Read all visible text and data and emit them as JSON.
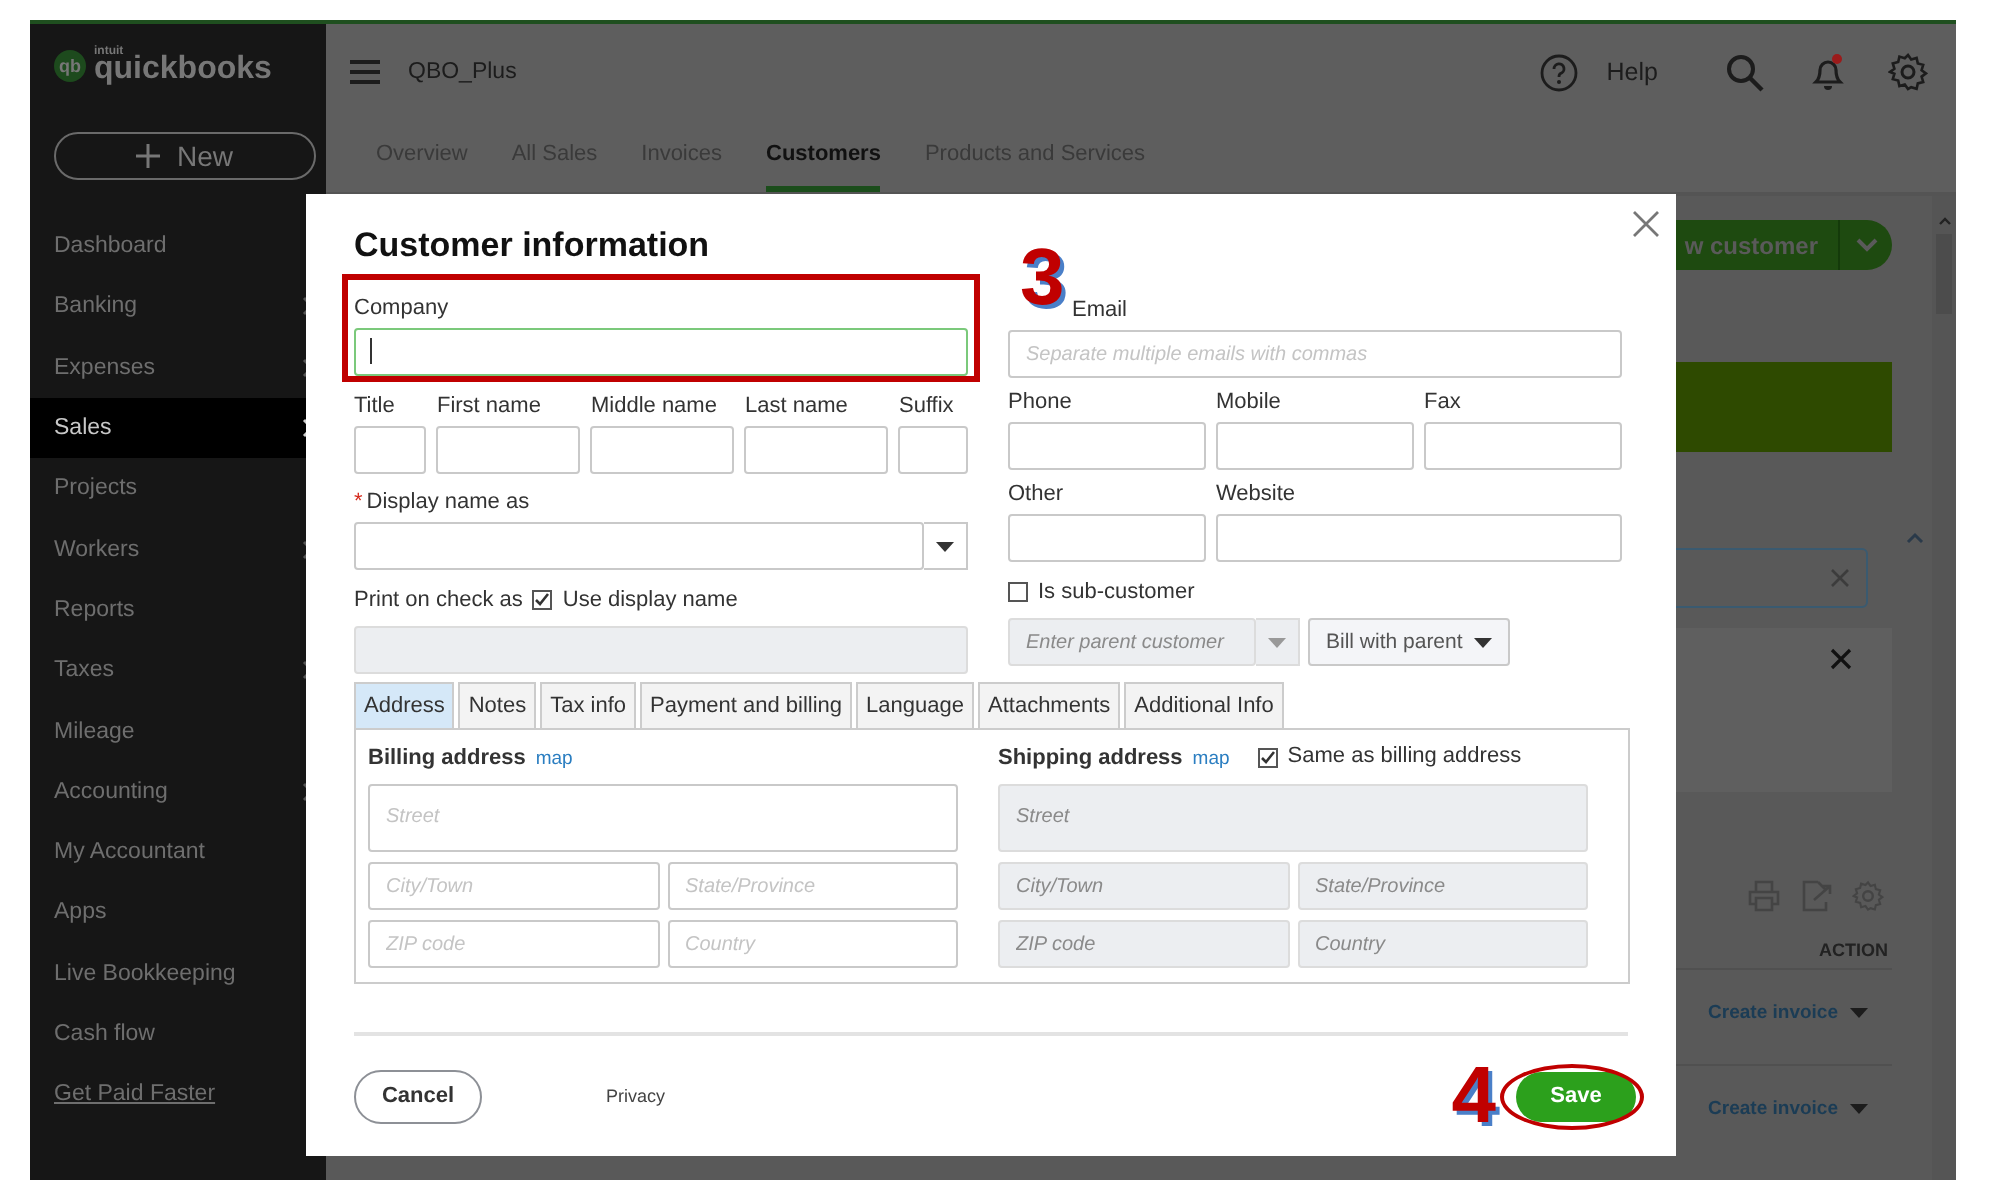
{
  "sidebar": {
    "logo": {
      "badge": "qb",
      "small": "intuit",
      "name": "quickbooks"
    },
    "new_button": "New",
    "items": [
      {
        "label": "Dashboard",
        "selected": false,
        "submenu": false,
        "kind": "nav"
      },
      {
        "label": "Banking",
        "selected": false,
        "submenu": true,
        "kind": "nav"
      },
      {
        "label": "Expenses",
        "selected": false,
        "submenu": true,
        "kind": "nav"
      },
      {
        "label": "Sales",
        "selected": true,
        "submenu": true,
        "kind": "nav"
      },
      {
        "label": "Projects",
        "selected": false,
        "submenu": false,
        "kind": "nav"
      },
      {
        "label": "Workers",
        "selected": false,
        "submenu": true,
        "kind": "nav"
      },
      {
        "label": "Reports",
        "selected": false,
        "submenu": false,
        "kind": "nav"
      },
      {
        "label": "Taxes",
        "selected": false,
        "submenu": true,
        "kind": "nav"
      },
      {
        "label": "Mileage",
        "selected": false,
        "submenu": false,
        "kind": "nav"
      },
      {
        "label": "Accounting",
        "selected": false,
        "submenu": true,
        "kind": "nav"
      },
      {
        "label": "My Accountant",
        "selected": false,
        "submenu": false,
        "kind": "nav"
      },
      {
        "label": "Apps",
        "selected": false,
        "submenu": false,
        "kind": "nav"
      },
      {
        "label": "Live Bookkeeping",
        "selected": false,
        "submenu": false,
        "kind": "nav"
      },
      {
        "label": "Cash flow",
        "selected": false,
        "submenu": false,
        "kind": "nav"
      },
      {
        "label": "Get Paid Faster",
        "selected": false,
        "submenu": false,
        "kind": "link"
      }
    ]
  },
  "header": {
    "company": "QBO_Plus",
    "help": "Help",
    "has_notification": true
  },
  "tabs": [
    {
      "label": "Overview",
      "selected": false
    },
    {
      "label": "All Sales",
      "selected": false
    },
    {
      "label": "Invoices",
      "selected": false
    },
    {
      "label": "Customers",
      "selected": true
    },
    {
      "label": "Products and Services",
      "selected": false
    }
  ],
  "background": {
    "new_customer_button": "w customer",
    "action_header": "ACTION",
    "rows": [
      {
        "action": "Create invoice"
      },
      {
        "action": "Create invoice"
      }
    ]
  },
  "dialog": {
    "title": "Customer information",
    "company": {
      "label": "Company",
      "focused": true
    },
    "email": {
      "label": "Email",
      "placeholder": "Separate multiple emails with commas"
    },
    "name_fields": [
      {
        "label": "Title"
      },
      {
        "label": "First name"
      },
      {
        "label": "Middle name"
      },
      {
        "label": "Last name"
      },
      {
        "label": "Suffix"
      }
    ],
    "phone_fields": [
      {
        "label": "Phone"
      },
      {
        "label": "Mobile"
      },
      {
        "label": "Fax"
      }
    ],
    "other_fields": [
      {
        "label": "Other"
      },
      {
        "label": "Website"
      }
    ],
    "display_name": {
      "label": "Display name as",
      "required_mark": "*"
    },
    "print_on_check": {
      "label": "Print on check as",
      "checkbox_label": "Use display name",
      "checked": true
    },
    "sub_customer": {
      "label": "Is sub-customer",
      "checked": false,
      "parent_placeholder": "Enter parent customer",
      "billing": "Bill with parent"
    },
    "tabs": [
      {
        "label": "Address",
        "selected": true
      },
      {
        "label": "Notes",
        "selected": false
      },
      {
        "label": "Tax info",
        "selected": false
      },
      {
        "label": "Payment and billing",
        "selected": false
      },
      {
        "label": "Language",
        "selected": false
      },
      {
        "label": "Attachments",
        "selected": false
      },
      {
        "label": "Additional Info",
        "selected": false
      }
    ],
    "billing": {
      "title": "Billing address",
      "link": "map",
      "street_placeholder": "Street",
      "city_placeholder": "City/Town",
      "state_placeholder": "State/Province",
      "zip_placeholder": "ZIP code",
      "country_placeholder": "Country"
    },
    "shipping": {
      "title": "Shipping address",
      "link": "map",
      "same_label": "Same as billing address",
      "same_checked": true,
      "street_placeholder": "Street",
      "city_placeholder": "City/Town",
      "state_placeholder": "State/Province",
      "zip_placeholder": "ZIP code",
      "country_placeholder": "Country"
    },
    "cancel": "Cancel",
    "privacy": "Privacy",
    "save": "Save"
  },
  "annotations": {
    "company_step": "3",
    "save_step": "4"
  }
}
